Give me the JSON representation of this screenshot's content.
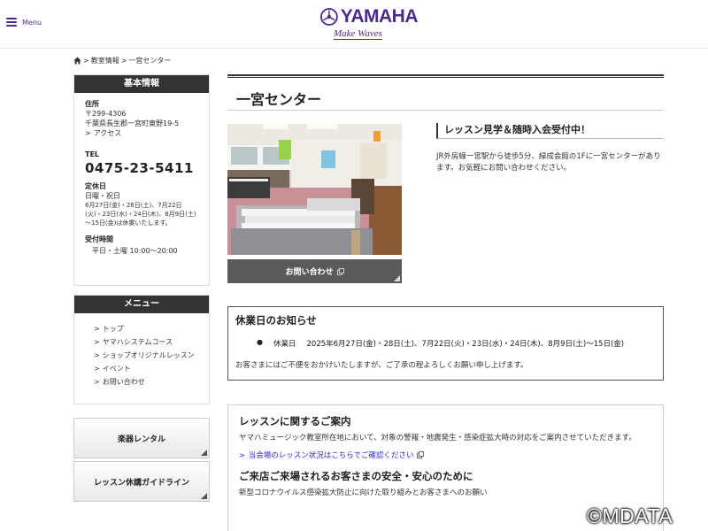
{
  "header": {
    "menu_label": "Menu",
    "logo_text": "YAMAHA",
    "logo_tagline": "Make Waves",
    "brand_color": "#4b2a8c"
  },
  "breadcrumb": {
    "sep": ">",
    "items": [
      "教室情報",
      "一宮センター"
    ]
  },
  "sidebar": {
    "info": {
      "heading": "基本情報",
      "address_label": "住所",
      "postal": "〒299-4306",
      "address": "千葉県長生郡一宮町東野19-5",
      "access_link": "アクセス",
      "tel_label": "TEL",
      "tel": "0475-23-5411",
      "closed_label": "定休日",
      "closed_main": "日曜・祝日",
      "closed_extra": "6月27日(金)・28日(土)、7月22日(火)・23日(水)・24日(木)、8月9日(土)～15日(金)は休業いたします。",
      "hours_label": "受付時間",
      "hours": "平日・土曜 10:00～20:00"
    },
    "menu": {
      "heading": "メニュー",
      "items": [
        "トップ",
        "ヤマハシステムコース",
        "ショップオリジナルレッスン",
        "イベント",
        "お問い合わせ"
      ]
    },
    "buttons": [
      "楽器レンタル",
      "レッスン休講ガイドライン"
    ]
  },
  "main": {
    "title": "一宮センター",
    "contact_button": "お問い合わせ",
    "lesson": {
      "heading": "レッスン見学＆随時入会受付中！",
      "desc": "JR外房線一宮駅から徒歩5分、緑成会館の1Fに一宮センターがあります。お気軽にお問い合わせください。"
    },
    "notice": {
      "title": "休業日のお知らせ",
      "item_label": "休業日",
      "item_dates": "2025年6月27日(金)・28日(土)、7月22日(火)・23日(水)・24日(木)、8月9日(土)～15日(金)",
      "footer": "お客さまにはご不便をおかけいたしますが、ご了承の程よろしくお願い申し上げます。"
    },
    "guide": {
      "title": "レッスンに関するご案内",
      "text": "ヤマハミュージック教室所在地において、対象の警報・地震発生・感染症拡大時の対応をご案内させていただきます。",
      "link": "当会場のレッスン状況はこちらでご確認ください",
      "title2": "ご来店ご来場されるお客さまの安全・安心のために",
      "text2": "新型コロナウイルス感染拡大防止に向けた取り組みとお客さまへのお願い"
    }
  },
  "watermark": "©MDATA"
}
